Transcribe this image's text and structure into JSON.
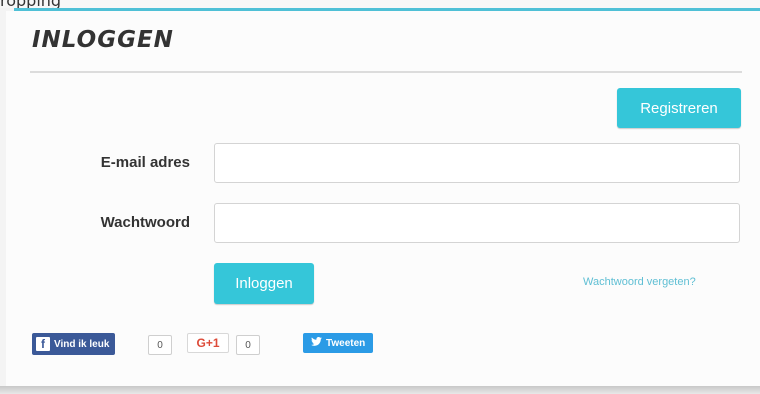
{
  "header": {
    "partial_text": "ropping"
  },
  "page": {
    "title": "INLOGGEN"
  },
  "form": {
    "register_label": "Registreren",
    "email_label": "E-mail adres",
    "email_value": "",
    "password_label": "Wachtwoord",
    "password_value": "",
    "login_label": "Inloggen",
    "forgot_label": "Wachtwoord vergeten?"
  },
  "social": {
    "facebook_label": "Vind ik leuk",
    "facebook_count": "0",
    "gplus_label": "G+1",
    "gplus_count": "0",
    "twitter_label": "Tweeten"
  },
  "colors": {
    "accent": "#35c6d9",
    "facebook": "#3b5998",
    "twitter": "#2b9be6",
    "gplus": "#dd4b39"
  },
  "icons": [
    "facebook-icon",
    "twitter-bird-icon"
  ]
}
